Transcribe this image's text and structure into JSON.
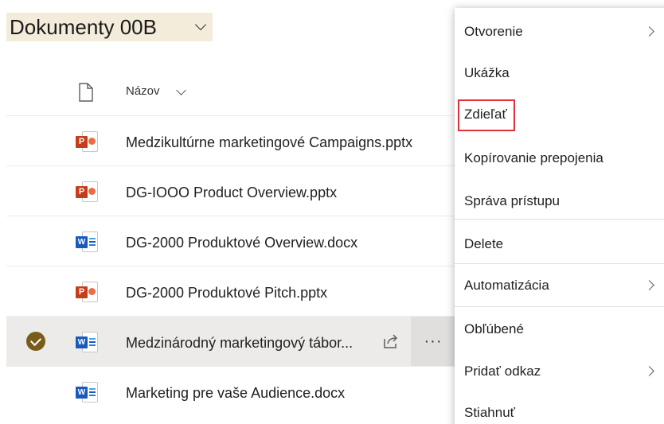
{
  "header": {
    "title": "Dokumenty 00B"
  },
  "columns": {
    "name_label": "Názov"
  },
  "files": [
    {
      "name": "Medzikultúrne marketingové Campaigns.pptx",
      "type": "ppt",
      "selected": false
    },
    {
      "name": "DG-IOOO Product Overview.pptx",
      "type": "ppt",
      "selected": false
    },
    {
      "name": "DG-2000 Produktové Overview.docx",
      "type": "word",
      "selected": false
    },
    {
      "name": "DG-2000 Produktové Pitch.pptx",
      "type": "ppt",
      "selected": false
    },
    {
      "name": "Medzinárodný marketingový tábor...",
      "type": "word",
      "selected": true
    },
    {
      "name": "Marketing pre vaše Audience.docx",
      "type": "word",
      "selected": false
    }
  ],
  "row_actions": {
    "more": "···"
  },
  "context_menu": {
    "items": [
      {
        "label": "Otvorenie",
        "submenu": true
      },
      {
        "label": "Ukážka",
        "submenu": false
      },
      {
        "label": "Zdieľať",
        "submenu": false,
        "highlighted": true
      },
      {
        "label": "Kopírovanie prepojenia",
        "submenu": false
      },
      {
        "label": "Správa prístupu",
        "submenu": false
      },
      {
        "label": "Delete",
        "submenu": false
      },
      {
        "label": "Automatizácia",
        "submenu": true
      },
      {
        "label": "Obľúbené",
        "submenu": false
      },
      {
        "label": "Pridať odkaz",
        "submenu": true
      },
      {
        "label": "Stiahnuť",
        "submenu": false
      }
    ]
  },
  "colors": {
    "ppt": "#c43e1c",
    "word": "#185abd",
    "selected_check": "#7a5c1a",
    "highlight_border": "#e0303a"
  }
}
